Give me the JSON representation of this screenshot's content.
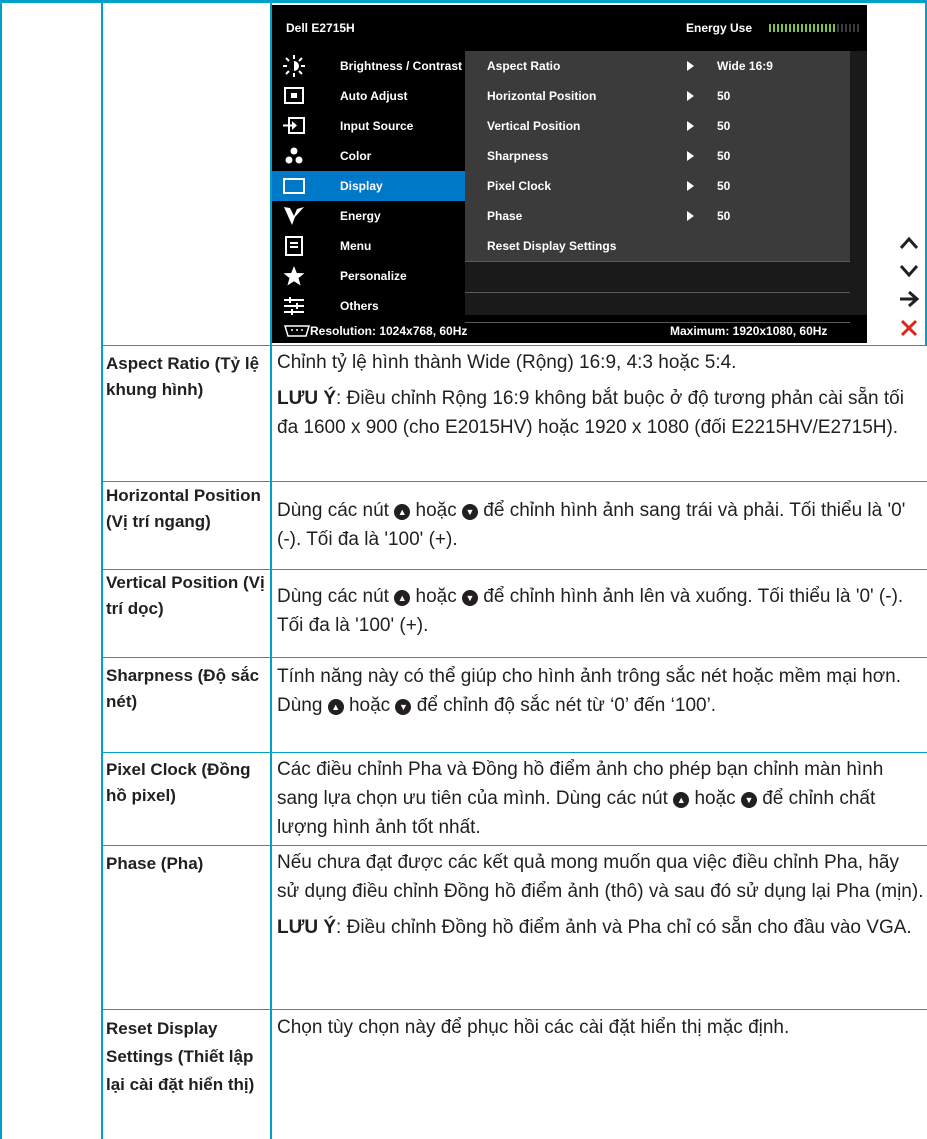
{
  "osd": {
    "model": "Dell E2715H",
    "energy_label": "Energy Use",
    "energy_level": 0.72,
    "menu": [
      {
        "label": "Brightness / Contrast",
        "icon": "brightness-icon",
        "active": false
      },
      {
        "label": "Auto Adjust",
        "icon": "auto-adjust-icon",
        "active": false
      },
      {
        "label": "Input Source",
        "icon": "input-source-icon",
        "active": false
      },
      {
        "label": "Color",
        "icon": "color-icon",
        "active": false
      },
      {
        "label": "Display",
        "icon": "display-icon",
        "active": true
      },
      {
        "label": "Energy",
        "icon": "energy-icon",
        "active": false
      },
      {
        "label": "Menu",
        "icon": "menu-icon",
        "active": false
      },
      {
        "label": "Personalize",
        "icon": "star-icon",
        "active": false
      },
      {
        "label": "Others",
        "icon": "sliders-icon",
        "active": false
      }
    ],
    "submenu": [
      {
        "label": "Aspect Ratio",
        "value": "Wide 16:9"
      },
      {
        "label": "Horizontal Position",
        "value": "50"
      },
      {
        "label": "Vertical Position",
        "value": "50"
      },
      {
        "label": "Sharpness",
        "value": "50"
      },
      {
        "label": "Pixel Clock",
        "value": "50"
      },
      {
        "label": "Phase",
        "value": "50"
      },
      {
        "label": "Reset Display Settings",
        "value": ""
      }
    ],
    "resolution": "Resolution: 1024x768,  60Hz",
    "maximum": "Maximum: 1920x1080,  60Hz"
  },
  "side_buttons": [
    "up-arrow-icon",
    "down-arrow-icon",
    "right-arrow-icon",
    "close-icon"
  ],
  "table": [
    {
      "term": "Aspect Ratio (Tỷ lệ khung hình)",
      "desc": [
        "Chỉnh tỷ lệ hình thành Wide (Rộng) 16:9, 4:3 hoặc 5:4."
      ],
      "note_label": "LƯU Ý",
      "note": ": Điều chỉnh Rộng 16:9 không bắt buộc ở độ tương phản cài sẵn tối đa 1600 x 900 (cho E2015HV) hoặc 1920 x 1080 (đối E2215HV/E2715H)."
    },
    {
      "term": "Horizontal Position (Vị trí ngang)",
      "desc_pre": "Dùng các nút",
      "desc_mid": "hoặc",
      "desc_post": "để chỉnh hình ảnh sang trái và phải. Tối thiểu là '0' (-). Tối đa là '100' (+)."
    },
    {
      "term": "Vertical Position (Vị trí dọc)",
      "desc_pre": " Dùng các nút",
      "desc_mid": "hoặc",
      "desc_post": "để chỉnh hình ảnh lên và xuống. Tối thiểu là '0' (-). Tối đa là '100' (+)."
    },
    {
      "term": "Sharpness (Độ sắc nét)",
      "desc_pre": "Tính năng này có thể giúp cho hình ảnh trông sắc nét hoặc mềm mại hơn. Dùng",
      "desc_mid": "hoặc",
      "desc_post": "để chỉnh độ sắc nét từ ‘0’ đến ‘100’."
    },
    {
      "term": "Pixel Clock (Đồng hồ pixel)",
      "desc_pre": "Các điều chỉnh Pha và Đồng hồ điểm ảnh cho phép bạn chỉnh màn hình sang lựa chọn ưu tiên của mình. Dùng các nút",
      "desc_mid": "hoặc",
      "desc_post": "để chỉnh chất lượng hình ảnh tốt nhất."
    },
    {
      "term": "Phase (Pha)",
      "desc": [
        "Nếu chưa đạt được các kết quả mong muốn qua việc điều chỉnh Pha, hãy sử dụng điều chỉnh Đồng hồ điểm ảnh (thô) và sau đó sử dụng lại Pha (mịn)."
      ],
      "note_label": "LƯU Ý",
      "note": ": Điều chỉnh Đồng hồ điểm ảnh và Pha chỉ có sẵn cho đầu vào VGA."
    },
    {
      "term": "Reset Display Settings (Thiết lập lại cài đặt hiển thị)",
      "desc": [
        "Chọn tùy chọn này để phục hồi các cài đặt hiển thị mặc định."
      ]
    }
  ]
}
